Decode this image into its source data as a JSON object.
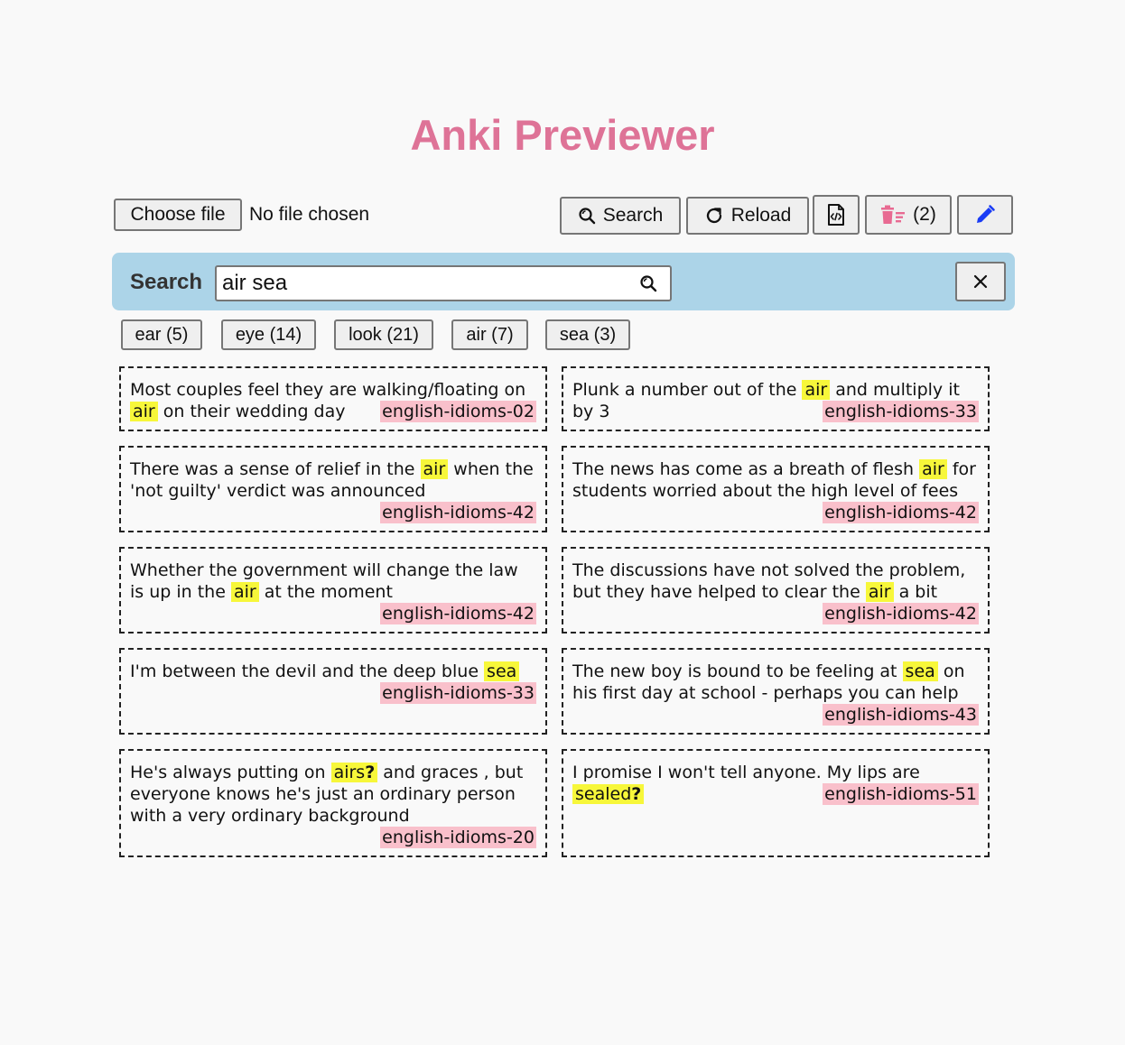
{
  "app": {
    "title": "Anki Previewer"
  },
  "toolbar": {
    "choose_file_label": "Choose file",
    "file_status": "No file chosen",
    "search_label": "Search",
    "reload_label": "Reload",
    "trash_count": "(2)"
  },
  "search": {
    "label": "Search",
    "value": "air sea",
    "clear_label": "×"
  },
  "tags": [
    {
      "label": "ear (5)"
    },
    {
      "label": "eye (14)"
    },
    {
      "label": "look (21)"
    },
    {
      "label": "air (7)"
    },
    {
      "label": "sea (3)"
    }
  ],
  "cards": [
    {
      "before": "Most couples feel they are walking/floating on ",
      "highlight": "air",
      "mark": "",
      "after": " on their wedding day",
      "deck": "english-idioms-02"
    },
    {
      "before": "Plunk a number out of the ",
      "highlight": "air",
      "mark": "",
      "after": " and multiply it by 3",
      "deck": "english-idioms-33"
    },
    {
      "before": "There was a sense of relief in the ",
      "highlight": "air",
      "mark": "",
      "after": " when the 'not guilty' verdict was announced",
      "deck": "english-idioms-42"
    },
    {
      "before": "The news has come as a breath of flesh ",
      "highlight": "air",
      "mark": "",
      "after": " for students worried about the high level of fees",
      "deck": "english-idioms-42"
    },
    {
      "before": "Whether the government will change the law is up in the ",
      "highlight": "air",
      "mark": "",
      "after": " at the moment",
      "deck": "english-idioms-42"
    },
    {
      "before": "The discussions have not solved the problem, but they have helped to clear the ",
      "highlight": "air",
      "mark": "",
      "after": " a bit",
      "deck": "english-idioms-42"
    },
    {
      "before": "I'm between the devil and the deep blue ",
      "highlight": "sea",
      "mark": "",
      "after": "",
      "deck": "english-idioms-33"
    },
    {
      "before": "The new boy is bound to be feeling at ",
      "highlight": "sea",
      "mark": "",
      "after": " on his first day at school - perhaps you can help",
      "deck": "english-idioms-43"
    },
    {
      "before": "He's always putting on ",
      "highlight": "airs",
      "mark": "?",
      "after": " and graces , but everyone knows he's just an ordinary person with a very ordinary background",
      "deck": "english-idioms-20"
    },
    {
      "before": "I promise I won't tell anyone. My lips are ",
      "highlight": "sealed",
      "mark": "?",
      "after": "",
      "deck": "english-idioms-51"
    }
  ],
  "colors": {
    "title": "#de7397",
    "search_bar": "#acd4e8",
    "highlight": "#f7f73a",
    "deck_tag": "#f9c0cb",
    "edit_icon": "#1a3cf5",
    "trash_icon": "#e86a92"
  },
  "icons": {
    "search": "search-icon",
    "reload": "reload-icon",
    "export": "code-file-icon",
    "trash": "trash-icon",
    "edit": "pencil-icon",
    "clear": "close-icon"
  }
}
